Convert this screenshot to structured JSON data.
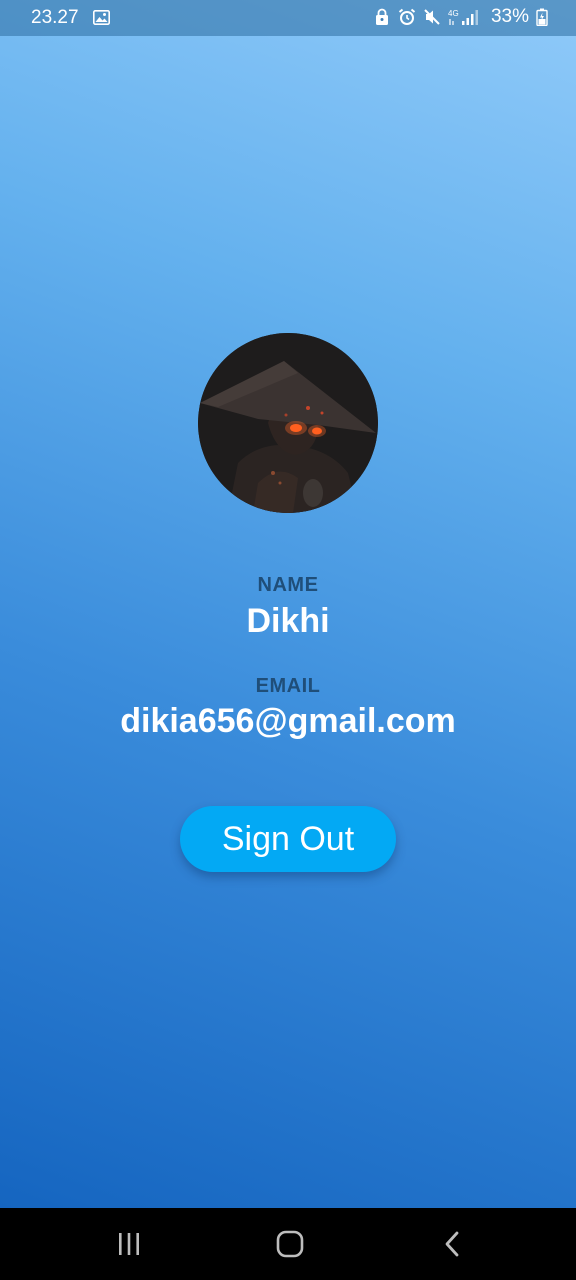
{
  "status_bar": {
    "time": "23.27",
    "battery": "33%",
    "network": "4G"
  },
  "profile": {
    "name_label": "NAME",
    "name": "Dikhi",
    "email_label": "EMAIL",
    "email": "dikia656@gmail.com",
    "sign_out_label": "Sign Out"
  },
  "colors": {
    "gradient_top": "#90CAF9",
    "gradient_bottom": "#1565C0",
    "label": "#1F4E79",
    "button": "#03A9F4"
  },
  "icons": {
    "status": [
      "gallery-icon",
      "lock-icon",
      "alarm-icon",
      "mute-icon",
      "signal-icon",
      "battery-icon"
    ],
    "nav": [
      "recent-apps-icon",
      "home-icon",
      "back-icon"
    ]
  }
}
